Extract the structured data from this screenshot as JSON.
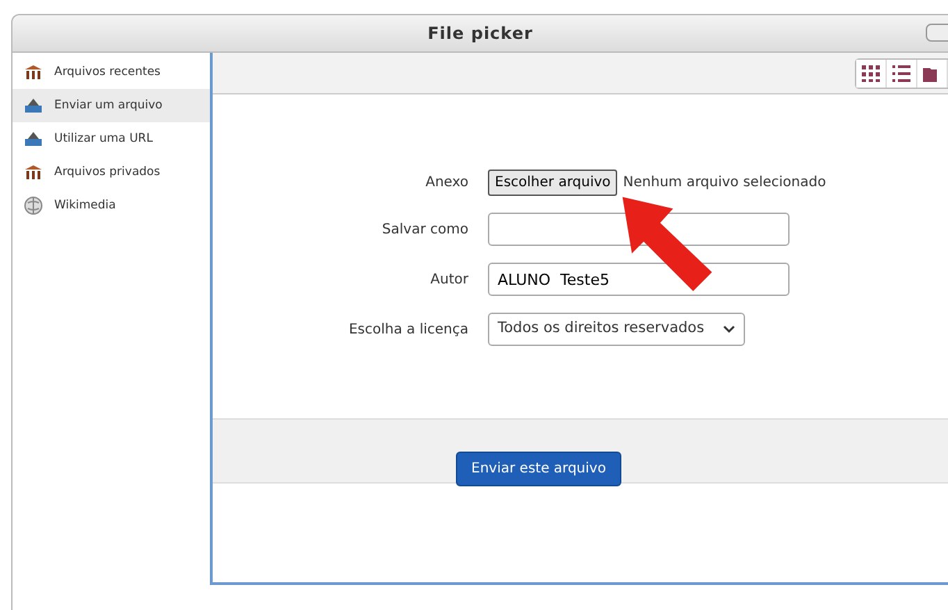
{
  "window": {
    "title": "File picker"
  },
  "sidebar": {
    "items": [
      {
        "label": "Arquivos recentes",
        "kind": "repository",
        "selected": false
      },
      {
        "label": "Enviar um arquivo",
        "kind": "upload",
        "selected": true
      },
      {
        "label": "Utilizar uma URL",
        "kind": "upload",
        "selected": false
      },
      {
        "label": "Arquivos privados",
        "kind": "repository",
        "selected": false
      },
      {
        "label": "Wikimedia",
        "kind": "globe",
        "selected": false
      }
    ]
  },
  "toolbar": {
    "views": [
      {
        "kind": "grid"
      },
      {
        "kind": "list"
      },
      {
        "kind": "tree"
      }
    ]
  },
  "form": {
    "fields": [
      {
        "label": "Anexo",
        "kind": "file",
        "button": "Escolher arquivo",
        "status": "Nenhum arquivo selecionado"
      },
      {
        "label": "Salvar como",
        "kind": "text"
      },
      {
        "label": "Autor",
        "kind": "text",
        "value": "ALUNO  Teste5"
      },
      {
        "label": "Escolha a licença",
        "kind": "select",
        "value": "Todos os direitos reservados"
      }
    ],
    "submit": "Enviar este arquivo"
  }
}
